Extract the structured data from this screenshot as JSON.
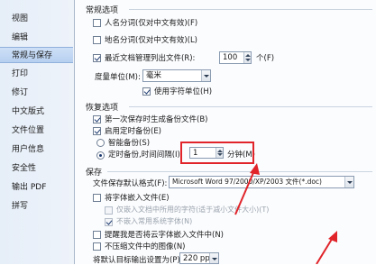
{
  "sidebar": {
    "items": [
      {
        "label": "视图"
      },
      {
        "label": "编辑"
      },
      {
        "label": "常规与保存"
      },
      {
        "label": "打印"
      },
      {
        "label": "修订"
      },
      {
        "label": "中文版式"
      },
      {
        "label": "文件位置"
      },
      {
        "label": "用户信息"
      },
      {
        "label": "安全性"
      },
      {
        "label": "输出 PDF"
      },
      {
        "label": "拼写"
      }
    ],
    "active_index": 2
  },
  "general": {
    "title": "常规选项",
    "person_names": "人名分词(仅对中文有效)(F)",
    "place_names": "地名分词(仅对中文有效)(L)",
    "recent_files": "最近文档管理列出文件(R):",
    "recent_count": "100",
    "recent_unit": "个(F)",
    "measure_label": "度量单位(M):",
    "measure_value": "毫米",
    "char_unit": "使用字符单位(H)"
  },
  "backup": {
    "title": "恢复选项",
    "first_save": "第一次保存时生成备份文件(B)",
    "timed_backup": "启用定时备份(E)",
    "smart_backup": "智能备份(S)",
    "timed_interval": "定时备份,时间间隔(I):",
    "interval_value": "1",
    "interval_unit": "分钟(M)"
  },
  "save": {
    "title": "保存",
    "default_format_label": "文件保存默认格式(F):",
    "default_format_value": "Microsoft Word 97/2000/XP/2003 文件(*.doc)",
    "embed_fonts": "将字体嵌入文件(E)",
    "embed_used_chars": "仅嵌入文档中所用的字符(适于减小文件大小)(T)",
    "no_common_fonts": "不嵌入常用系统字体(N)",
    "remind_cloud_fonts": "提醒我是否将云字体嵌入文件中(N)",
    "no_compress_images": "不压缩文件中的图像(N)",
    "default_output_label": "将默认目标输出设置为(P):",
    "default_output_value": "220 ppi"
  },
  "colors": {
    "highlight": "#e0242a"
  }
}
